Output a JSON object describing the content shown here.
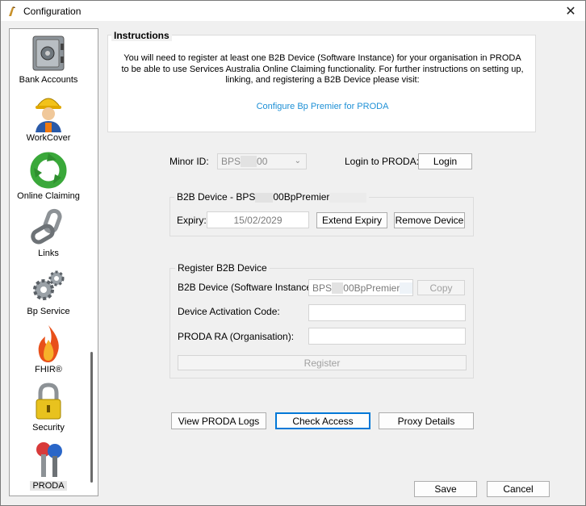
{
  "window": {
    "title": "Configuration",
    "close_glyph": "✕"
  },
  "nav": {
    "items": [
      {
        "label": "Bank Accounts",
        "icon": "safe-icon"
      },
      {
        "label": "WorkCover",
        "icon": "worker-icon"
      },
      {
        "label": "Online Claiming",
        "icon": "recycle-arrows-icon"
      },
      {
        "label": "Links",
        "icon": "chain-link-icon"
      },
      {
        "label": "Bp Service",
        "icon": "gears-icon"
      },
      {
        "label": "FHIR®",
        "icon": "flame-icon"
      },
      {
        "label": "Security",
        "icon": "padlock-icon"
      },
      {
        "label": "PRODA",
        "icon": "keys-icon",
        "selected": true
      }
    ]
  },
  "instructions": {
    "title": "Instructions",
    "text": "You will need to register at least one B2B Device (Software Instance) for your organisation in PRODA to be able to use Services Australia Online Claiming functionality. For further instructions on setting up, linking, and registering a B2B Device please visit:",
    "link": "Configure Bp Premier for PRODA"
  },
  "minor_id": {
    "label": "Minor ID:",
    "prefix": "BPS",
    "suffix": "00"
  },
  "login": {
    "label": "Login to PRODA:",
    "button": "Login"
  },
  "b2b_device": {
    "title_prefix": "B2B Device - BPS",
    "title_suffix": "00BpPremier",
    "expiry_label": "Expiry:",
    "expiry_value": "15/02/2029",
    "extend_button": "Extend Expiry",
    "remove_button": "Remove Device"
  },
  "register": {
    "title": "Register B2B Device",
    "software_label": "B2B Device (Software Instance):",
    "software_prefix": "BPS",
    "software_suffix": "00BpPremier",
    "copy_button": "Copy",
    "activation_label": "Device Activation Code:",
    "activation_value": "",
    "ra_label": "PRODA RA (Organisation):",
    "ra_value": "",
    "register_button": "Register"
  },
  "actions": {
    "view_logs": "View PRODA Logs",
    "check_access": "Check Access",
    "proxy_details": "Proxy Details"
  },
  "footer": {
    "save": "Save",
    "cancel": "Cancel"
  },
  "colors": {
    "link": "#1e90d6",
    "accent": "#0078d7"
  }
}
